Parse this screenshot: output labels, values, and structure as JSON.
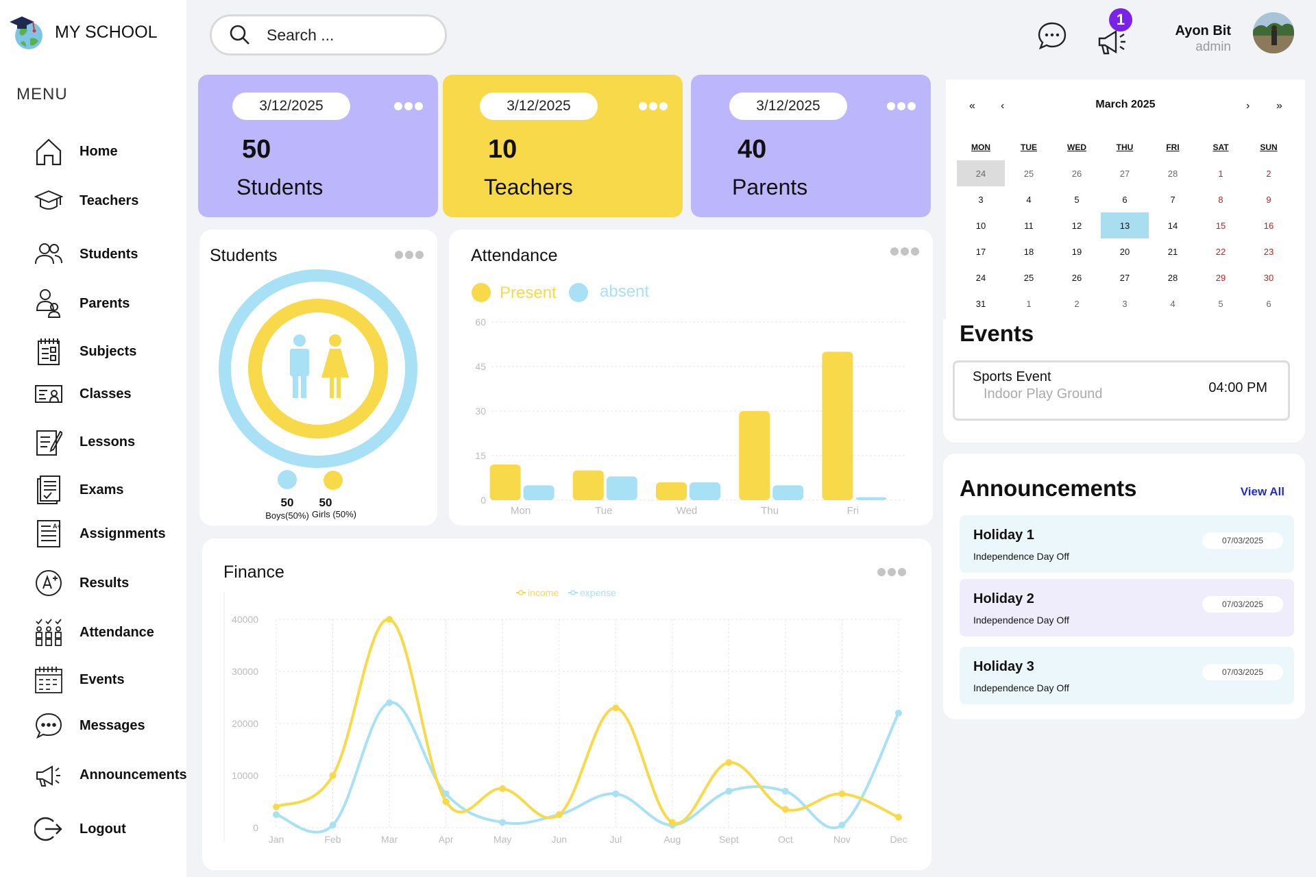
{
  "app": {
    "name": "MY SCHOOL",
    "menu_title": "MENU"
  },
  "colors": {
    "purple": "#bcb6fc",
    "yellow": "#f8d94a",
    "blue": "#a8e1f5",
    "badge": "#7a22e8",
    "link": "#1d2ad6"
  },
  "nav": [
    {
      "label": "Home",
      "icon": "home-icon"
    },
    {
      "label": "Teachers",
      "icon": "graduation-cap-icon"
    },
    {
      "label": "Students",
      "icon": "users-icon"
    },
    {
      "label": "Parents",
      "icon": "parents-icon"
    },
    {
      "label": "Subjects",
      "icon": "notebook-icon"
    },
    {
      "label": "Classes",
      "icon": "classroom-board-icon"
    },
    {
      "label": "Lessons",
      "icon": "edit-document-icon"
    },
    {
      "label": "Exams",
      "icon": "exam-sheet-icon"
    },
    {
      "label": "Assignments",
      "icon": "assignment-icon"
    },
    {
      "label": "Results",
      "icon": "grade-badge-icon"
    },
    {
      "label": "Attendance",
      "icon": "attendance-group-icon"
    },
    {
      "label": "Events",
      "icon": "calendar-icon"
    },
    {
      "label": "Messages",
      "icon": "chat-bubble-icon"
    },
    {
      "label": "Announcements",
      "icon": "megaphone-icon"
    },
    {
      "label": "Logout",
      "icon": "logout-icon"
    }
  ],
  "search": {
    "placeholder": "Search ..."
  },
  "header": {
    "notification_count": "1",
    "user_name": "Ayon Bit",
    "user_role": "admin"
  },
  "stats": [
    {
      "date": "3/12/2025",
      "value": "50",
      "label": "Students"
    },
    {
      "date": "3/12/2025",
      "value": "10",
      "label": "Teachers"
    },
    {
      "date": "3/12/2025",
      "value": "40",
      "label": "Parents"
    }
  ],
  "students_panel": {
    "title": "Students",
    "boys_count": "50",
    "boys_label": "Boys(50%)",
    "girls_count": "50",
    "girls_label": "Girls (50%)"
  },
  "attendance_panel": {
    "title": "Attendance",
    "legend_present": "Present",
    "legend_absent": "absent"
  },
  "finance_panel": {
    "title": "Finance",
    "legend_income": "income",
    "legend_expense": "expense"
  },
  "calendar": {
    "month": "March 2025",
    "nav": {
      "prev_year": "«",
      "prev": "‹",
      "next": "›",
      "next_year": "»"
    },
    "weekdays": [
      "MON",
      "TUE",
      "WED",
      "THU",
      "FRI",
      "SAT",
      "SUN"
    ],
    "days": [
      "24",
      "25",
      "26",
      "27",
      "28",
      "1",
      "2",
      "3",
      "4",
      "5",
      "6",
      "7",
      "8",
      "9",
      "10",
      "11",
      "12",
      "13",
      "14",
      "15",
      "16",
      "17",
      "18",
      "19",
      "20",
      "21",
      "22",
      "23",
      "24",
      "25",
      "26",
      "27",
      "28",
      "29",
      "30",
      "31",
      "1",
      "2",
      "3",
      "4",
      "5",
      "6"
    ]
  },
  "events": {
    "title": "Events",
    "items": [
      {
        "name": "Sports Event",
        "location": "Indoor Play Ground",
        "time": "04:00 PM"
      }
    ]
  },
  "announcements": {
    "title": "Announcements",
    "view_all": "View All",
    "items": [
      {
        "title": "Holiday 1",
        "subtitle": "Independence Day Off",
        "date": "07/03/2025"
      },
      {
        "title": "Holiday 2",
        "subtitle": "Independence Day Off",
        "date": "07/03/2025"
      },
      {
        "title": "Holiday 3",
        "subtitle": "Independence Day Off",
        "date": "07/03/2025"
      }
    ]
  },
  "chart_data": [
    {
      "type": "bar",
      "title": "Attendance",
      "categories": [
        "Mon",
        "Tue",
        "Wed",
        "Thu",
        "Fri"
      ],
      "series": [
        {
          "name": "Present",
          "values": [
            12,
            10,
            6,
            30,
            50
          ]
        },
        {
          "name": "absent",
          "values": [
            5,
            8,
            6,
            5,
            1
          ]
        }
      ],
      "ylim": [
        0,
        60
      ],
      "yticks": [
        "0",
        "15",
        "30",
        "45",
        "60"
      ],
      "grid": true,
      "legend": "top-left"
    },
    {
      "type": "line",
      "title": "Finance",
      "categories": [
        "Jan",
        "Feb",
        "Mar",
        "Apr",
        "May",
        "Jun",
        "Jul",
        "Aug",
        "Sept",
        "Oct",
        "Nov",
        "Dec"
      ],
      "series": [
        {
          "name": "income",
          "values": [
            4000,
            10000,
            40000,
            5000,
            7500,
            2500,
            23000,
            1000,
            12500,
            3500,
            6500,
            2000
          ]
        },
        {
          "name": "expense",
          "values": [
            2500,
            500,
            24000,
            6500,
            1000,
            2500,
            6500,
            500,
            7000,
            7000,
            500,
            22000
          ]
        }
      ],
      "ylim": [
        0,
        40000
      ],
      "yticks": [
        "0",
        "10000",
        "20000",
        "30000",
        "40000"
      ],
      "grid": true,
      "legend": "top-center"
    }
  ]
}
